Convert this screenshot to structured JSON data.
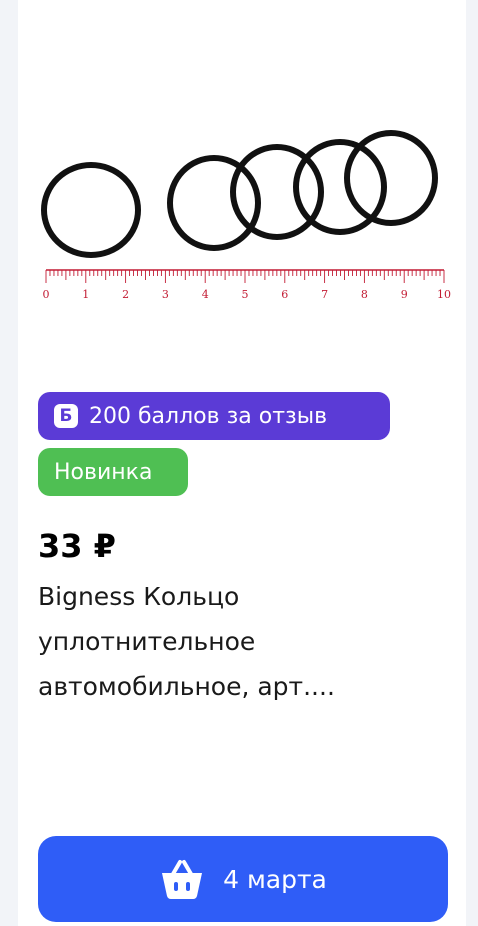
{
  "card": {
    "image_alt": "rubber o-rings with ruler",
    "ruler_labels": [
      "0",
      "1",
      "2",
      "3",
      "4",
      "5",
      "6",
      "7",
      "8",
      "9",
      "10"
    ],
    "points_badge": {
      "icon_letter": "Б",
      "label": "200 баллов за отзыв",
      "color": "#5b3bd6"
    },
    "new_badge": {
      "label": "Новинка",
      "color": "#4fbf53"
    },
    "price": "33 ₽",
    "title_lines": [
      "Bigness Кольцо",
      "уплотнительное",
      "автомобильное, арт...."
    ],
    "buy_button": {
      "icon": "basket-icon",
      "label": "4 марта",
      "color": "#2f5df7"
    }
  }
}
